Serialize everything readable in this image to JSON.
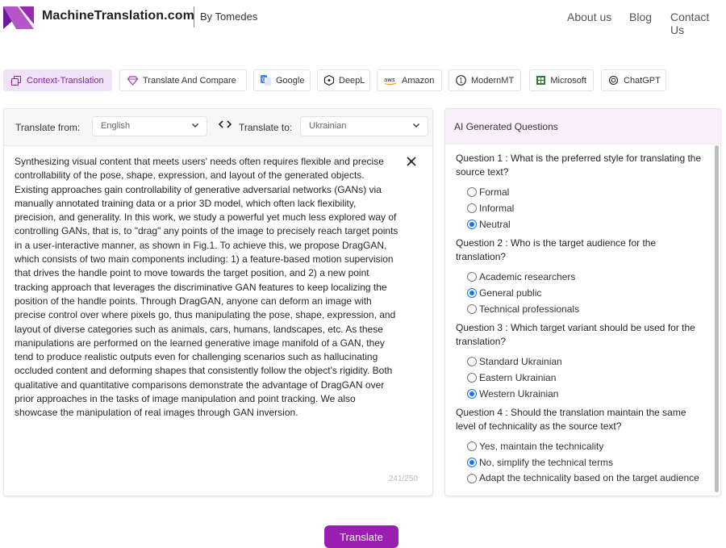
{
  "header": {
    "brand": "MachineTranslation.com",
    "by": "By Tomedes",
    "nav": [
      {
        "label": "About us"
      },
      {
        "label": "Blog"
      },
      {
        "label": "Contact Us"
      }
    ]
  },
  "engines": [
    {
      "label": "Context-Translation",
      "icon": "copy-icon",
      "active": true
    },
    {
      "label": "Translate And Compare",
      "icon": "diamond-icon",
      "active": false
    },
    {
      "label": "Google",
      "icon": "google-translate-icon",
      "active": false
    },
    {
      "label": "DeepL",
      "icon": "deepl-icon",
      "active": false
    },
    {
      "label": "Amazon",
      "icon": "aws-icon",
      "active": false
    },
    {
      "label": "ModernMT",
      "icon": "modernmt-icon",
      "active": false
    },
    {
      "label": "Microsoft",
      "icon": "microsoft-icon",
      "active": false
    },
    {
      "label": "ChatGPT",
      "icon": "openai-icon",
      "active": false
    }
  ],
  "translator": {
    "from_label": "Translate from:",
    "from_value": "English",
    "to_label": "Translate to:",
    "to_value": "Ukrainian",
    "source_text": "Synthesizing visual content that meets users' needs often requires flexible and precise controllability of the pose, shape, expression, and layout of the generated objects. Existing approaches gain controllability of generative adversarial networks (GANs) via manually annotated training data or a prior 3D model, which often lack flexibility, precision, and generality. In this work, we study a powerful yet much less explored way of controlling GANs, that is, to \"drag\" any points of the image to precisely reach target points in a user-interactive manner, as shown in Fig.1. To achieve this, we propose DragGAN, which consists of two main components including: 1) a feature-based motion supervision that drives the handle point to move towards the target position, and 2) a new point tracking approach that leverages the discriminative GAN features to keep localizing the position of the handle points. Through DragGAN, anyone can deform an image with precise control over where pixels go, thus manipulating the pose, shape, expression, and layout of diverse categories such as animals, cars, humans, landscapes, etc. As these manipulations are performed on the learned generative image manifold of a GAN, they tend to produce realistic outputs even for challenging scenarios such as hallucinating occluded content and deforming shapes that consistently follow the object's rigidity. Both qualitative and quantitative comparisons demonstrate the advantage of DragGAN over prior approaches in the tasks of image manipulation and point tracking. We also showcase the manipulation of real images through GAN inversion.",
    "counter": "241/250",
    "translate_button": "Translate"
  },
  "questions_panel": {
    "title": "AI Generated Questions",
    "questions": [
      {
        "text": "Question 1 : What is the preferred style for translating the source text?",
        "options": [
          {
            "label": "Formal",
            "selected": false
          },
          {
            "label": "Informal",
            "selected": false
          },
          {
            "label": "Neutral",
            "selected": true
          }
        ]
      },
      {
        "text": "Question 2 : Who is the target audience for the translation?",
        "options": [
          {
            "label": "Academic researchers",
            "selected": false
          },
          {
            "label": "General public",
            "selected": true
          },
          {
            "label": "Technical professionals",
            "selected": false
          }
        ]
      },
      {
        "text": "Question 3 : Which target variant should be used for the translation?",
        "options": [
          {
            "label": "Standard Ukrainian",
            "selected": false
          },
          {
            "label": "Eastern Ukrainian",
            "selected": false
          },
          {
            "label": "Western Ukrainian",
            "selected": true
          }
        ]
      },
      {
        "text": "Question 4 : Should the translation maintain the same level of technicality as the source text?",
        "options": [
          {
            "label": "Yes, maintain the technicality",
            "selected": false
          },
          {
            "label": "No, simplify the technical terms",
            "selected": true
          },
          {
            "label": "Adapt the technicality based on the target audience",
            "selected": false
          }
        ]
      }
    ]
  },
  "colors": {
    "accent": "#9a1fb0",
    "active_tab_bg": "#f1e3f7",
    "radio_selected": "#1a73e8",
    "questions_header_bg": "#fbeefb"
  }
}
